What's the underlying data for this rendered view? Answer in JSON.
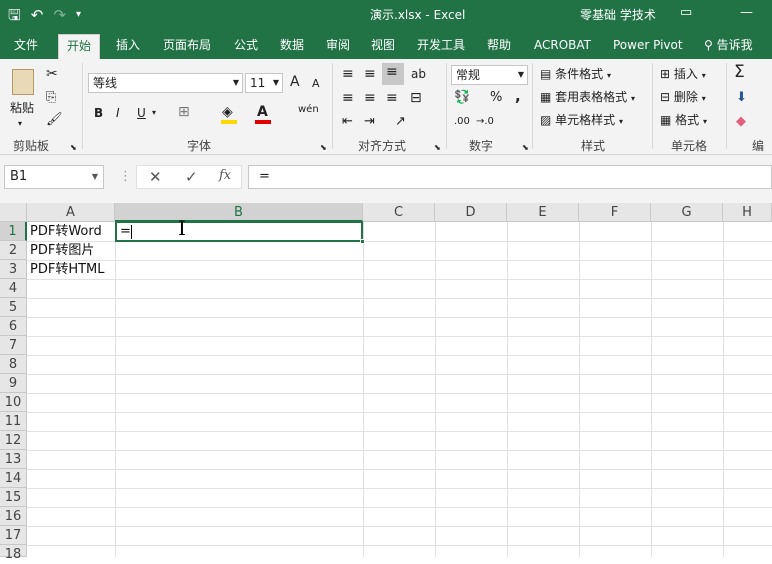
{
  "titlebar": {
    "save_icon": "save-icon",
    "undo_icon": "undo-icon",
    "redo_icon": "redo-icon",
    "customize_icon": "customize-qat-icon",
    "doc_title": "演示.xlsx  -  Excel",
    "user_label": "零基础 学技术",
    "ribbon_display_icon": "ribbon-display-icon",
    "minimize_icon": "minimize-icon"
  },
  "tabs": [
    {
      "label": "文件"
    },
    {
      "label": "开始",
      "active": true
    },
    {
      "label": "插入"
    },
    {
      "label": "页面布局"
    },
    {
      "label": "公式"
    },
    {
      "label": "数据"
    },
    {
      "label": "审阅"
    },
    {
      "label": "视图"
    },
    {
      "label": "开发工具"
    },
    {
      "label": "帮助"
    },
    {
      "label": "ACROBAT"
    },
    {
      "label": "Power Pivot"
    }
  ],
  "tell_me": "告诉我",
  "ribbon": {
    "clipboard": {
      "paste": "粘贴",
      "label": "剪贴板"
    },
    "font": {
      "name": "等线",
      "size": "11",
      "grow": "A",
      "shrink": "A",
      "bold": "B",
      "italic": "I",
      "underline": "U",
      "phonetic": "wén",
      "label": "字体",
      "fill_color": "#ffd800",
      "font_color": "#e00000"
    },
    "alignment": {
      "label": "对齐方式",
      "wrap": "ab"
    },
    "number": {
      "format": "常规",
      "percent": "%",
      "comma": ",",
      "inc_decimal": ".00",
      "dec_decimal": "→.0",
      "label": "数字"
    },
    "styles": {
      "conditional": "条件格式",
      "table": "套用表格格式",
      "cell_styles": "单元格样式",
      "label": "样式"
    },
    "cells": {
      "insert": "插入",
      "delete": "删除",
      "format": "格式",
      "label": "单元格"
    },
    "editing": {
      "label": "编辑",
      "sum": "Σ"
    }
  },
  "formula_bar": {
    "name_box": "B1",
    "cancel": "✕",
    "enter": "✓",
    "fx": "fx",
    "formula": "="
  },
  "sheet": {
    "columns": [
      "A",
      "B",
      "C",
      "D",
      "E",
      "F",
      "G",
      "H"
    ],
    "rows": [
      "1",
      "2",
      "3",
      "4",
      "5",
      "6",
      "7",
      "8",
      "9",
      "10",
      "11",
      "12",
      "13",
      "14",
      "15",
      "16",
      "17",
      "18"
    ],
    "cells": [
      {
        "ref": "A1",
        "value": "PDF转Word"
      },
      {
        "ref": "A2",
        "value": "PDF转图片"
      },
      {
        "ref": "A3",
        "value": "PDF转HTML"
      },
      {
        "ref": "B1",
        "value": "="
      }
    ],
    "active_cell": "B1",
    "accent": "#217346"
  }
}
